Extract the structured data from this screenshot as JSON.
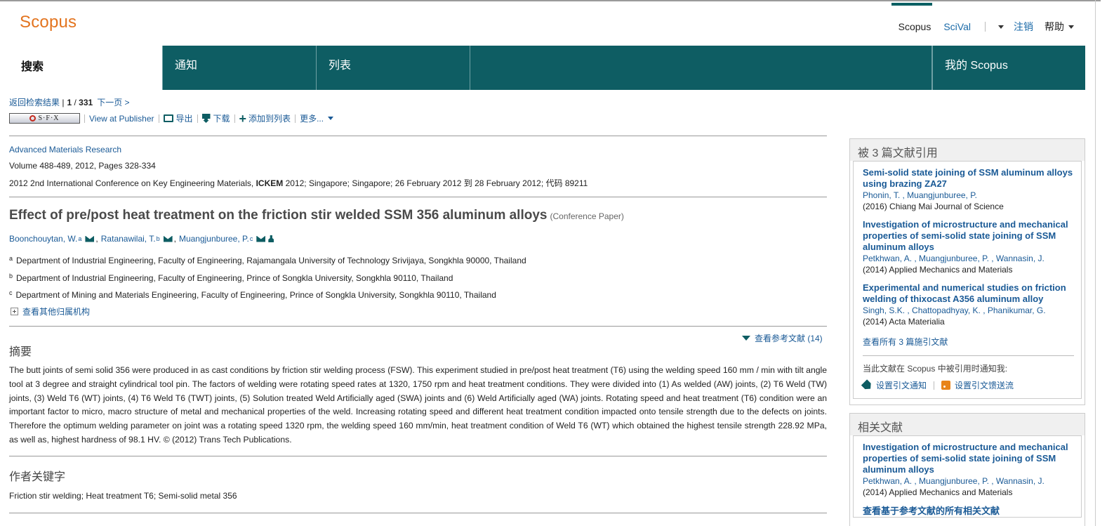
{
  "header": {
    "logo": "Scopus",
    "nav": {
      "scopus": "Scopus",
      "scival": "SciVal",
      "logout": "注销",
      "help": "帮助"
    }
  },
  "tabs": [
    {
      "label": "搜索",
      "active": true
    },
    {
      "label": "通知"
    },
    {
      "label": "列表"
    },
    {
      "label": "我的 Scopus"
    }
  ],
  "navrow": {
    "back": "返回检索结果",
    "position_current": "1",
    "position_total": "331",
    "next": "下一页 >"
  },
  "toolbar": {
    "sfx": "S·F·X",
    "view_publisher": "View at Publisher",
    "export": "导出",
    "download": "下载",
    "add_list": "添加到列表",
    "more": "更多..."
  },
  "doc": {
    "source": "Advanced Materials Research",
    "volume": "Volume 488-489, 2012, Pages 328-334",
    "conf_pre": "2012 2nd International Conference on Key Engineering Materials,",
    "conf_bold": "ICKEM",
    "conf_post": "2012; Singapore; Singapore; 26 February 2012 到 28 February 2012; 代码 89211",
    "title": "Effect of pre/post heat treatment on the friction stir welded SSM 356 aluminum alloys",
    "paper_type": "(Conference Paper)",
    "authors": [
      {
        "name": "Boonchouytan, W.",
        "sup": "a"
      },
      {
        "name": "Ratanawilai, T.",
        "sup": "b"
      },
      {
        "name": "Muangjunburee, P.",
        "sup": "c"
      }
    ],
    "affiliations": [
      {
        "sup": "a",
        "text": "Department of Industrial Engineering, Faculty of Engineering, Rajamangala University of Technology Srivijaya, Songkhla 90000, Thailand"
      },
      {
        "sup": "b",
        "text": "Department of Industrial Engineering, Faculty of Engineering, Prince of Songkla University, Songkhla 90110, Thailand"
      },
      {
        "sup": "c",
        "text": "Department of Mining and Materials Engineering, Faculty of Engineering, Prince of Songkla University, Songkhla 90110, Thailand"
      }
    ],
    "more_affiliations": "查看其他归属机构",
    "refs_link": "查看参考文献 (14)",
    "abstract_heading": "摘要",
    "abstract": "The butt joints of semi solid 356 were produced in as cast conditions by friction stir welding process (FSW). This experiment studied in pre/post heat treatment (T6) using the welding speed 160 mm / min with tilt angle tool at 3 degree and straight cylindrical tool pin. The factors of welding were rotating speed rates at 1320, 1750 rpm and heat treatment conditions. They were divided into (1) As welded (AW) joints, (2) T6 Weld (TW) joints, (3) Weld T6 (WT) joints, (4) T6 Weld T6 (TWT) joints, (5) Solution treated Weld Artificially aged (SWA) joints and (6) Weld Artificially aged (WA) joints. Rotating speed and heat treatment (T6) condition were an important factor to micro, macro structure of metal and mechanical properties of the weld. Increasing rotating speed and different heat treatment condition impacted onto tensile strength due to the defects on joints. Therefore the optimum welding parameter on joint was a rotating speed 1320 rpm, the welding speed 160 mm/min, heat treatment condition of Weld T6 (WT) which obtained the highest tensile strength 228.92 MPa, as well as, highest hardness of 98.1 HV. © (2012) Trans Tech Publications.",
    "keywords_heading": "作者关键字",
    "keywords": "Friction stir welding; Heat treatment T6; Semi-solid metal 356"
  },
  "cited_by": {
    "heading": "被 3 篇文献引用",
    "items": [
      {
        "title": "Semi-solid state joining of SSM aluminum alloys using brazing ZA27",
        "authors": "Phonin, T. , Muangjunburee, P.",
        "journal": "(2016) Chiang Mai Journal of Science"
      },
      {
        "title": "Investigation of microstructure and mechanical properties of semi-solid state joining of SSM aluminum alloys",
        "authors": "Petkhwan, A. , Muangjunburee, P. , Wannasin, J.",
        "journal": "(2014) Applied Mechanics and Materials"
      },
      {
        "title": "Experimental and numerical studies on friction welding of thixocast A356 aluminum alloy",
        "authors": "Singh, S.K. , Chattopadhyay, K. , Phanikumar, G.",
        "journal": "(2014) Acta Materialia"
      }
    ],
    "view_all": "查看所有 3 篇施引文献",
    "alert_text": "当此文献在 Scopus 中被引用时通知我:",
    "set_alert": "设置引文通知",
    "set_feed": "设置引文馈送流"
  },
  "related": {
    "heading": "相关文献",
    "items": [
      {
        "title": "Investigation of microstructure and mechanical properties of semi-solid state joining of SSM aluminum alloys",
        "authors": "Petkhwan, A. , Muangjunburee, P. , Wannasin, J.",
        "journal": "(2014) Applied Mechanics and Materials"
      }
    ],
    "view_all": "查看基于参考文献的所有相关文献"
  }
}
